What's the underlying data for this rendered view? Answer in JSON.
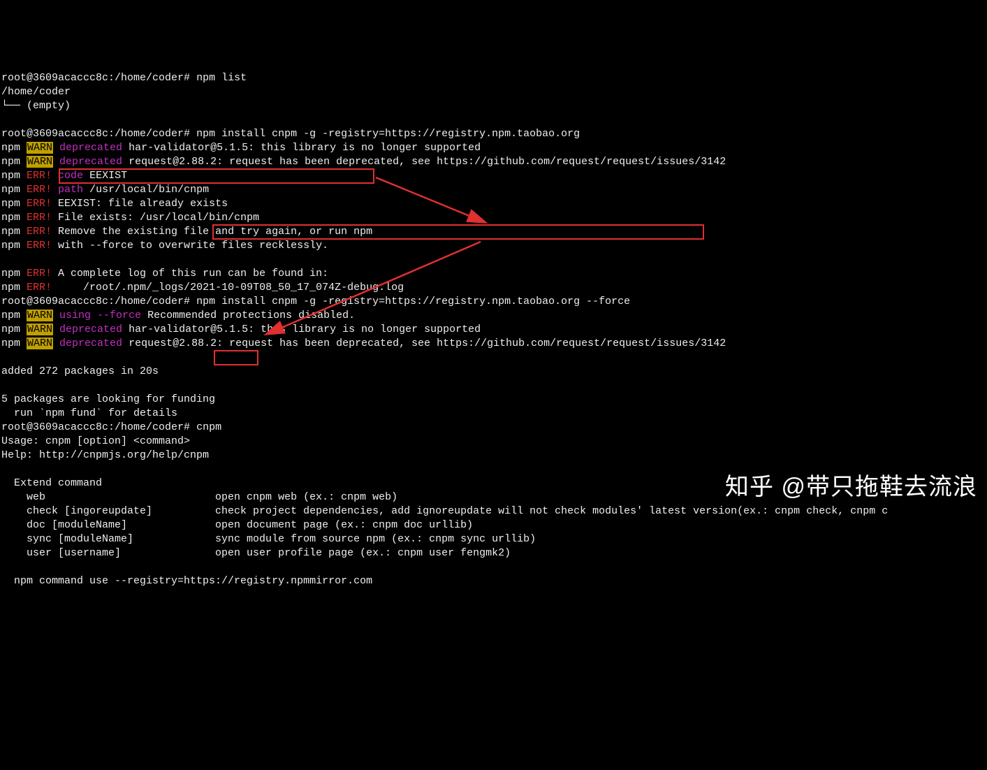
{
  "prompt": "root@3609acaccc8c:/home/coder#",
  "cmd_list": "npm list",
  "list_out1": "/home/coder",
  "list_out2": "└── (empty)",
  "cmd_install1": "npm install cnpm -g -registry=https://registry.npm.taobao.org",
  "npm_prefix": "npm ",
  "warn": "WARN",
  "err": "ERR!",
  "dep": "deprecated",
  "warn_har": " har-validator@5.1.5: this library is no longer supported",
  "warn_req": " request@2.88.2: request has been deprecated, see https://github.com/request/request/issues/3142",
  "code_label": "code",
  "code_val": " EEXIST",
  "path_label": "path",
  "path_val": " /usr/local/bin/cnpm",
  "err_eexist": " EEXIST: file already exists",
  "err_fileexists": " File exists: /usr/local/bin/cnpm",
  "err_remove": " Remove the existing file and try again, or run npm",
  "err_force": " with --force to overwrite files recklessly.",
  "err_log1": " A complete log of this run can be found in:",
  "err_log2": "     /root/.npm/_logs/2021-10-09T08_50_17_074Z-debug.log",
  "cmd_install2": "npm install cnpm -g -registry=https://registry.npm.taobao.org --force",
  "using_force": "using --force",
  "recommended": " Recommended protections disabled.",
  "added": "added 272 packages in 20s",
  "funding1": "5 packages are looking for funding",
  "funding2": "  run `npm fund` for details",
  "cmd_cnpm": "cnpm",
  "usage": "Usage: cnpm [option] <command>",
  "help": "Help: http://cnpmjs.org/help/cnpm",
  "extend_header": "  Extend command",
  "ext_web": "    web                           open cnpm web (ex.: cnpm web)",
  "ext_check": "    check [ingoreupdate]          check project dependencies, add ignoreupdate will not check modules' latest version(ex.: cnpm check, cnpm c",
  "ext_doc": "    doc [moduleName]              open document page (ex.: cnpm doc urllib)",
  "ext_sync": "    sync [moduleName]             sync module from source npm (ex.: cnpm sync urllib)",
  "ext_user": "    user [username]               open user profile page (ex.: cnpm user fengmk2)",
  "npm_cmd_use": "  npm command use --registry=https://registry.npmmirror.com",
  "watermark": "知乎 @带只拖鞋去流浪",
  "colors": {
    "err": "#e03030",
    "warn_bg": "#c0a000",
    "magenta": "#c030c0",
    "box": "#e03030"
  }
}
